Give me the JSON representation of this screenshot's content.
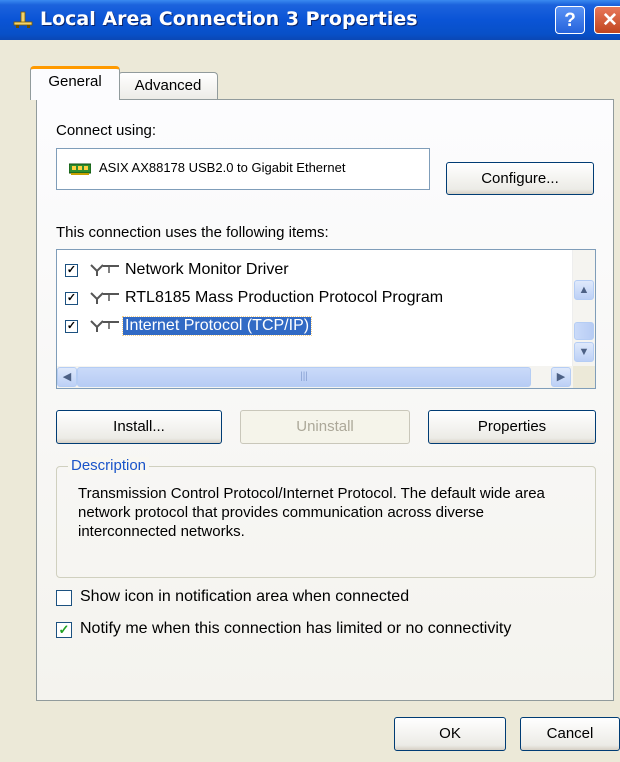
{
  "window": {
    "title": "Local Area Connection 3 Properties",
    "help_button": "?",
    "close_button": "✕"
  },
  "tabs": [
    {
      "label": "General",
      "active": true
    },
    {
      "label": "Advanced",
      "active": false
    }
  ],
  "connect_using": {
    "label": "Connect using:",
    "adapter_name": "ASIX AX88178 USB2.0 to Gigabit Ethernet",
    "configure_button": "Configure..."
  },
  "items_section": {
    "label": "This connection uses the following items:",
    "items": [
      {
        "label": "Network Monitor Driver",
        "checked": true,
        "selected": false
      },
      {
        "label": "RTL8185 Mass Production Protocol Program",
        "checked": true,
        "selected": false
      },
      {
        "label": "Internet Protocol (TCP/IP)",
        "checked": true,
        "selected": true
      }
    ]
  },
  "buttons": {
    "install": "Install...",
    "uninstall": "Uninstall",
    "properties": "Properties",
    "ok": "OK",
    "cancel": "Cancel"
  },
  "description": {
    "title": "Description",
    "text": "Transmission Control Protocol/Internet Protocol. The default wide area network protocol that provides communication across diverse interconnected networks."
  },
  "options": [
    {
      "label": "Show icon in notification area when connected",
      "checked": false
    },
    {
      "label": "Notify me when this connection has limited or no connectivity",
      "checked": true
    }
  ],
  "colors": {
    "titlebar": "#0a54d6",
    "selection": "#316ac5",
    "group_title": "#1a54c9",
    "dialog_bg": "#ECE9D8"
  }
}
